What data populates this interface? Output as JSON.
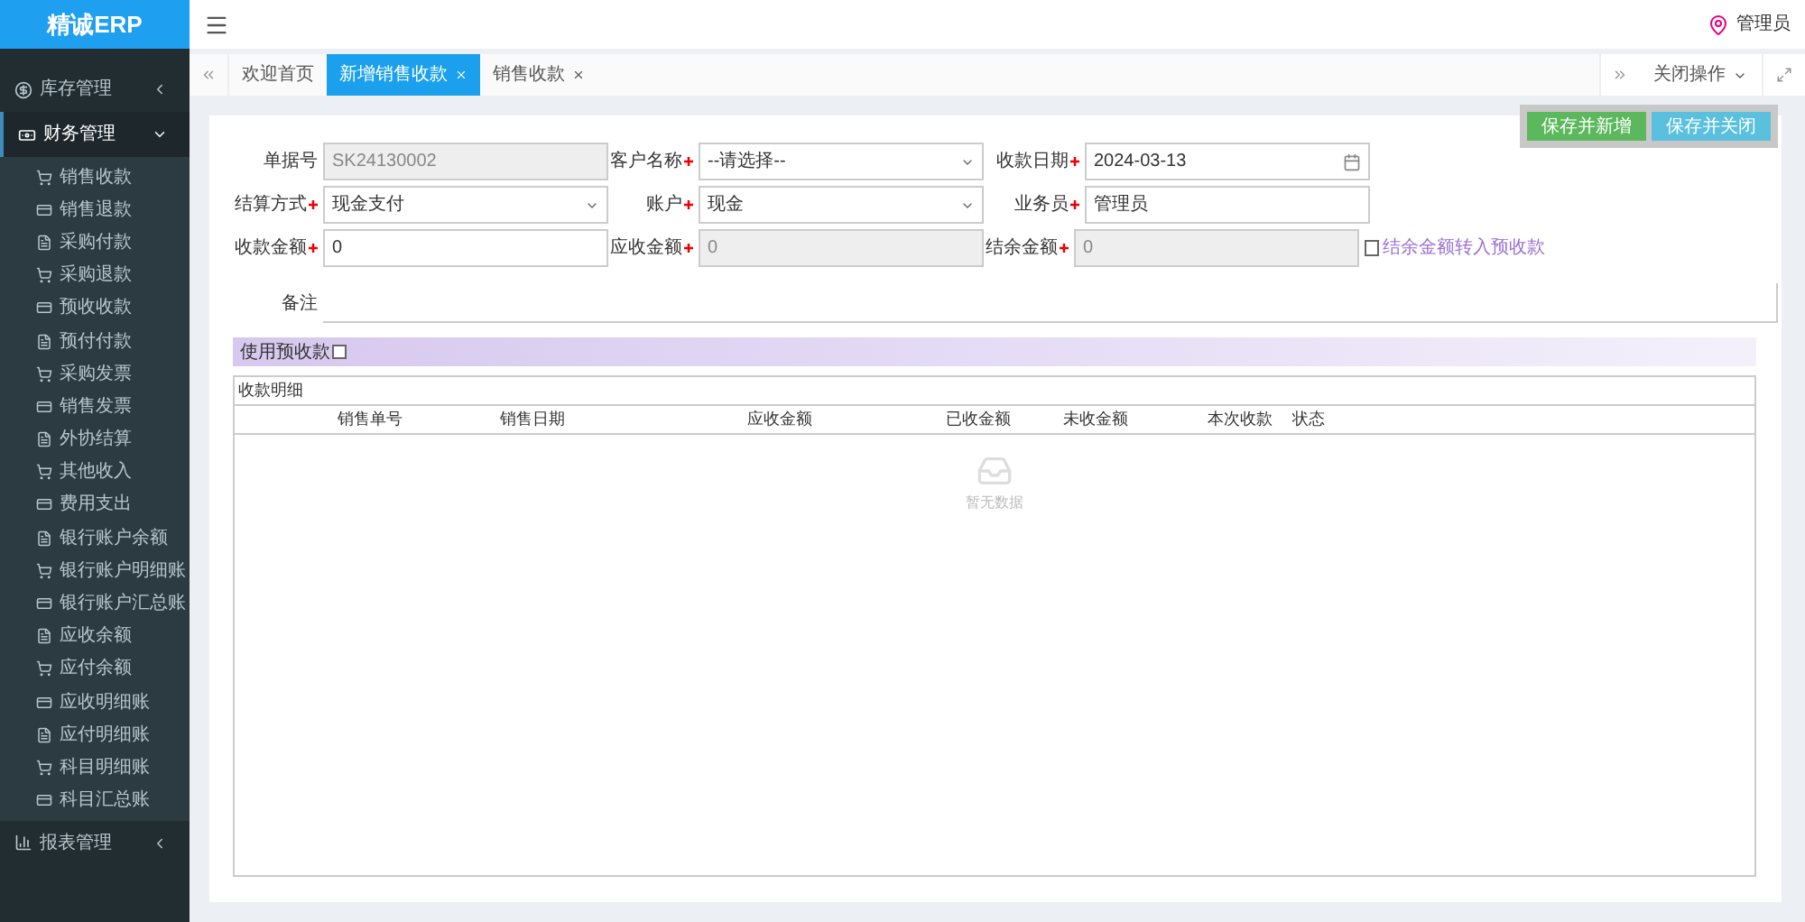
{
  "app": {
    "logo": "精诚ERP",
    "user": "管理员"
  },
  "sidebar": {
    "items": [
      {
        "label": "库存管理",
        "expanded": false
      },
      {
        "label": "财务管理",
        "expanded": true,
        "children": [
          {
            "label": "销售收款"
          },
          {
            "label": "销售退款"
          },
          {
            "label": "采购付款"
          },
          {
            "label": "采购退款"
          },
          {
            "label": "预收收款"
          },
          {
            "label": "预付付款"
          },
          {
            "label": "采购发票"
          },
          {
            "label": "销售发票"
          },
          {
            "label": "外协结算"
          },
          {
            "label": "其他收入"
          },
          {
            "label": "费用支出"
          },
          {
            "label": "银行账户余额"
          },
          {
            "label": "银行账户明细账"
          },
          {
            "label": "银行账户汇总账"
          },
          {
            "label": "应收余额"
          },
          {
            "label": "应付余额"
          },
          {
            "label": "应收明细账"
          },
          {
            "label": "应付明细账"
          },
          {
            "label": "科目明细账"
          },
          {
            "label": "科目汇总账"
          }
        ]
      },
      {
        "label": "报表管理",
        "expanded": false
      }
    ]
  },
  "tabs": [
    {
      "label": "欢迎首页",
      "selected": false,
      "closable": false
    },
    {
      "label": "新增销售收款",
      "selected": true,
      "closable": true
    },
    {
      "label": "销售收款",
      "selected": false,
      "closable": true
    }
  ],
  "tab_menu": "关闭操作",
  "buttons": [
    {
      "label": "保存并新增",
      "kind": "success"
    },
    {
      "label": "保存并关闭",
      "kind": "info"
    }
  ],
  "form": {
    "rows": [
      [
        {
          "label": "单据号",
          "kind": "input",
          "value": "SK24130002",
          "required": false,
          "disabled": true
        },
        {
          "label": "客户名称",
          "kind": "select",
          "value": "--请选择--",
          "required": true,
          "disabled": false
        },
        {
          "label": "收款日期",
          "kind": "date",
          "value": "2024-03-13",
          "required": true,
          "disabled": false
        }
      ],
      [
        {
          "label": "结算方式",
          "kind": "select",
          "value": "现金支付",
          "required": true,
          "disabled": false
        },
        {
          "label": "账户",
          "kind": "select",
          "value": "现金",
          "required": true,
          "disabled": false
        },
        {
          "label": "业务员",
          "kind": "input",
          "value": "管理员",
          "required": true,
          "disabled": false
        }
      ],
      [
        {
          "label": "收款金额",
          "kind": "input",
          "value": "0",
          "required": true,
          "disabled": false
        },
        {
          "label": "应收金额",
          "kind": "input",
          "value": "0",
          "required": true,
          "disabled": true
        },
        {
          "label": "结余金额",
          "kind": "input",
          "value": "0",
          "required": true,
          "disabled": true
        }
      ]
    ],
    "surplus_option": {
      "label": "结余金额转入预收款",
      "checked": false
    },
    "remark": {
      "label": "备注"
    }
  },
  "prepay": {
    "label": "使用预收款",
    "checked": false
  },
  "table": {
    "title": "收款明细",
    "columns": [
      "销售单号",
      "销售日期",
      "应收金额",
      "已收金额",
      "未收金额",
      "本次收款",
      "状态"
    ],
    "empty": "暂无数据"
  }
}
